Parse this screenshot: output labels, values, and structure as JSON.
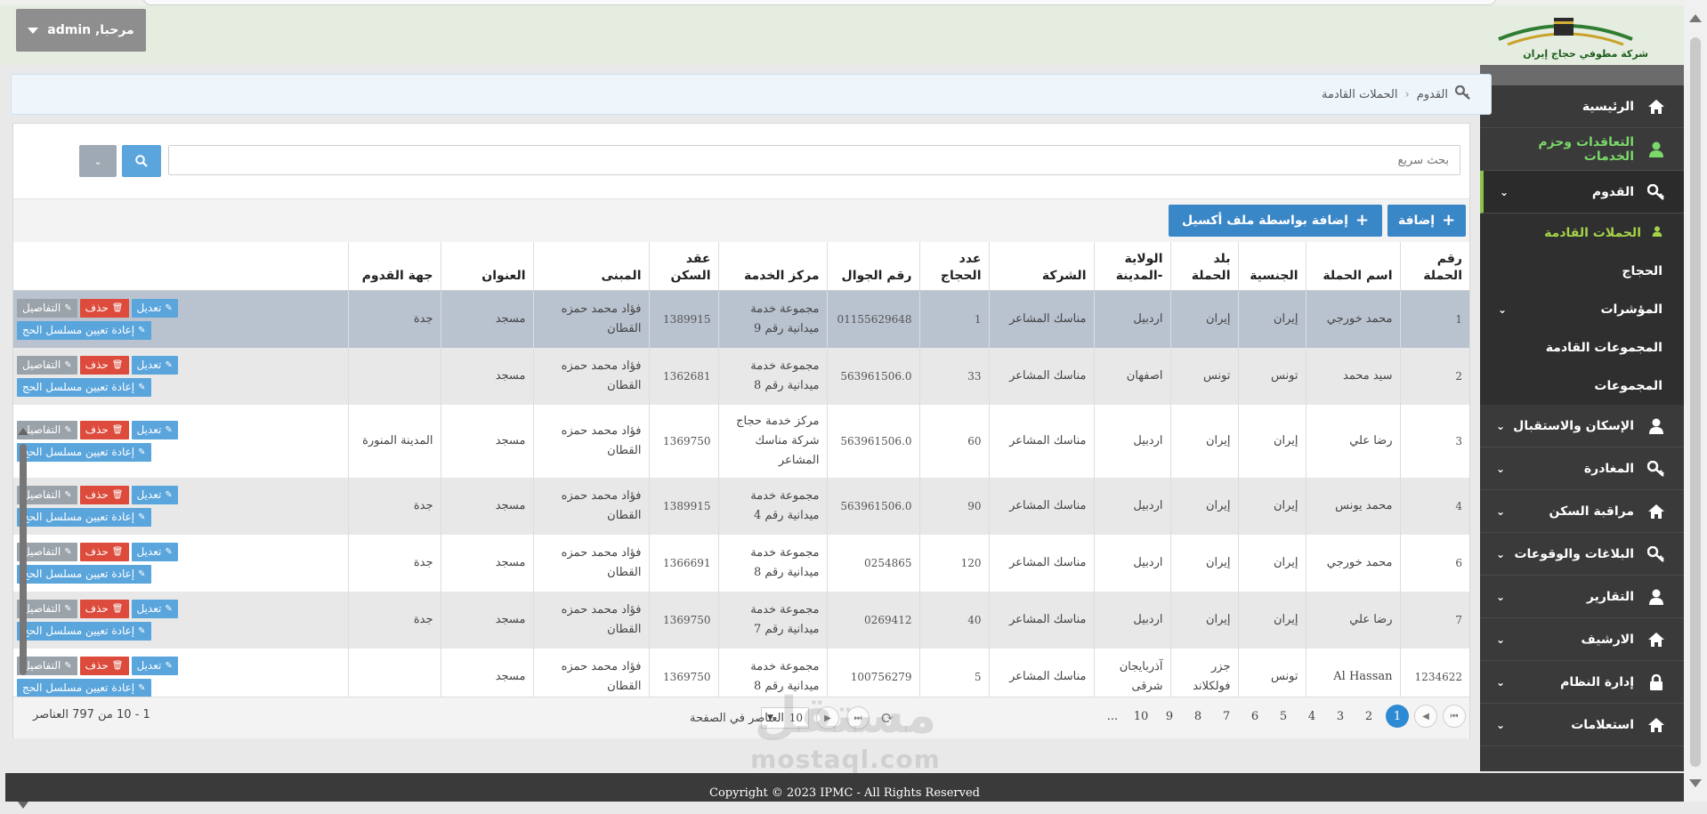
{
  "header": {
    "logo_text": "شركة مطوفي حجاج إيران",
    "user_greeting": "مرحبا, admin"
  },
  "sidebar": {
    "items": [
      {
        "label": "الرئيسية",
        "icon": "home-icon"
      },
      {
        "label": "التعاقدات وحزم الخدمات",
        "icon": "user-icon"
      },
      {
        "label": "القدوم",
        "icon": "key-icon"
      },
      {
        "label": "الحملات القادمة",
        "icon": "user-icon"
      },
      {
        "label": "الحجاج"
      },
      {
        "label": "المؤشرات"
      },
      {
        "label": "المجموعات القادمة"
      },
      {
        "label": "المجموعات"
      },
      {
        "label": "الإسكان والاستقبال",
        "icon": "user-icon"
      },
      {
        "label": "المغادرة",
        "icon": "key-icon"
      },
      {
        "label": "مراقبة السكن",
        "icon": "home-icon"
      },
      {
        "label": "البلاغات والوقوعات",
        "icon": "key-icon"
      },
      {
        "label": "التقارير",
        "icon": "user-icon"
      },
      {
        "label": "الارشيف",
        "icon": "home-icon"
      },
      {
        "label": "إدارة النظام",
        "icon": "lock-icon"
      },
      {
        "label": "استعلامات",
        "icon": "home-icon"
      }
    ]
  },
  "breadcrumb": {
    "root": "القدوم",
    "current": "الحملات القادمة"
  },
  "search": {
    "placeholder": "بحث سريع"
  },
  "toolbar": {
    "add_label": "إضافة",
    "add_excel_label": "إضافة بواسطة ملف أكسيل"
  },
  "table": {
    "columns": [
      "رقم الحملة",
      "اسم الحملة",
      "الجنسية",
      "بلد الحملة",
      "الولاية -المدينة",
      "الشركة",
      "عدد الحجاج",
      "رقم الجوال",
      "مركز الخدمة",
      "عقد السكن",
      "المبنى",
      "العنوان",
      "جهة القدوم"
    ],
    "actions": {
      "edit": "تعديل",
      "delete": "حذف",
      "details": "التفاصيل",
      "reassign": "إعادة تعيين مسلسل الحج"
    },
    "rows": [
      {
        "c": [
          "1",
          "محمد خورجي",
          "إيران",
          "إيران",
          "اردبيل",
          "مناسك المشاعر",
          "1",
          "01155629648",
          "مجموعة خدمة ميدانية رقم 9",
          "1389915",
          "فؤاد محمد حمزه القطان",
          "مسجد",
          "جدة"
        ]
      },
      {
        "c": [
          "2",
          "سيد محمد",
          "تونس",
          "تونس",
          "اصفهان",
          "مناسك المشاعر",
          "33",
          "563961506.0",
          "مجموعة خدمة ميدانية رقم 8",
          "1362681",
          "فؤاد محمد حمزه القطان",
          "مسجد",
          ""
        ]
      },
      {
        "c": [
          "3",
          "رضا علي",
          "إيران",
          "إيران",
          "اردبيل",
          "مناسك المشاعر",
          "60",
          "563961506.0",
          "مركز خدمة حجاج شركة مناسك المشاعر",
          "1369750",
          "فؤاد محمد حمزه القطان",
          "مسجد",
          "المدينة المنورة"
        ]
      },
      {
        "c": [
          "4",
          "محمد يونس",
          "إيران",
          "إيران",
          "اردبيل",
          "مناسك المشاعر",
          "90",
          "563961506.0",
          "مجموعة خدمة ميدانية رقم 4",
          "1389915",
          "فؤاد محمد حمزه القطان",
          "مسجد",
          "جدة"
        ]
      },
      {
        "c": [
          "6",
          "محمد خورجي",
          "إيران",
          "إيران",
          "اردبيل",
          "مناسك المشاعر",
          "120",
          "0254865",
          "مجموعة خدمة ميدانية رقم 8",
          "1366691",
          "فؤاد محمد حمزه القطان",
          "مسجد",
          "جدة"
        ]
      },
      {
        "c": [
          "7",
          "رضا علي",
          "إيران",
          "إيران",
          "اردبيل",
          "مناسك المشاعر",
          "40",
          "0269412",
          "مجموعة خدمة ميدانية رقم 7",
          "1369750",
          "فؤاد محمد حمزه القطان",
          "مسجد",
          "جدة"
        ]
      },
      {
        "c": [
          "1234622",
          "Al Hassan",
          "تونس",
          "جزر فولكلاند",
          "آذربايجان شرقى",
          "مناسك المشاعر",
          "5",
          "100756279",
          "مجموعة خدمة ميدانية رقم 8",
          "1369750",
          "فؤاد محمد حمزه القطان",
          "مسجد",
          ""
        ]
      }
    ]
  },
  "pager": {
    "pages": [
      "1",
      "2",
      "3",
      "4",
      "5",
      "6",
      "7",
      "8",
      "9",
      "10",
      "..."
    ],
    "current_page": "1",
    "page_size": "10",
    "page_size_label": "العناصر في الصفحة",
    "info": "1 - 10 من 797 العناصر"
  },
  "footer": {
    "copyright": "Copyright © 2023 IPMC - All Rights Reserved"
  },
  "watermark": {
    "text": "مستقل",
    "sub": "mostaql.com"
  },
  "colors": {
    "sidebar_bg": "#3a3a3a",
    "accent_green": "#8bc34a",
    "primary_blue": "#3a87c8",
    "delete_red": "#dc4b3b"
  }
}
